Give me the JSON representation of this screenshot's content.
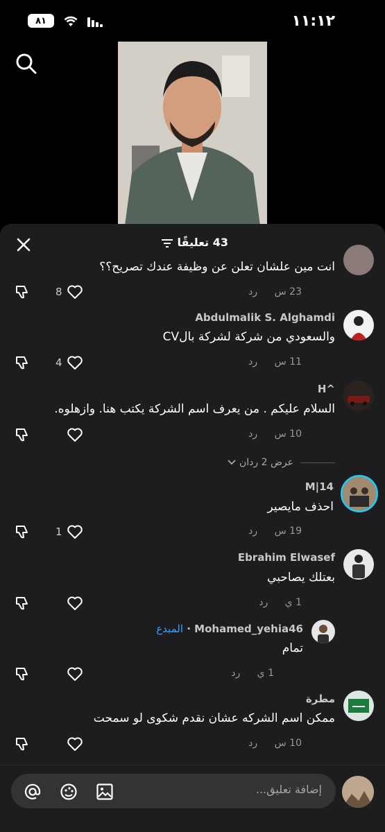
{
  "status": {
    "time": "١١:١٢",
    "battery": "٨١"
  },
  "video": {
    "description_icon": "video-person"
  },
  "sheet": {
    "count_label": "43 تعليقًا",
    "icons": {
      "close": "close-icon",
      "filter": "filter-icon"
    }
  },
  "comments": [
    {
      "name": "",
      "text": "انت مين علشان تعلن عن وظيفة عندك تصريح؟؟",
      "time": "23 س",
      "reply": "رد",
      "likes": "8"
    },
    {
      "name": "Abdulmalik S. Alghamdi",
      "text": "والسعودي من شركة لشركة بالCV",
      "time": "11 س",
      "reply": "رد",
      "likes": "4"
    },
    {
      "name": "H^",
      "text": "السلام عليكم . من يعرف اسم الشركة يكتب هنا. وازهلوه.",
      "time": "10 س",
      "reply": "رد",
      "likes": ""
    },
    {
      "name": "M|14",
      "text": "احذف مايصير",
      "time": "19 س",
      "reply": "رد",
      "likes": "1"
    },
    {
      "name": "Ebrahim Elwasef",
      "text": "بعتلك يصاحبي",
      "time": "1 ي",
      "reply": "رد",
      "likes": ""
    },
    {
      "name": "Mohamed_yehia46",
      "author_tag": "المبدع",
      "text": "تمام",
      "time": "1 ي",
      "reply": "رد",
      "likes": ""
    },
    {
      "name": "مطرة",
      "text": "ممكن اسم الشركه عشان نقدم شكوى لو سمحت",
      "time": "10 س",
      "reply": "رد",
      "likes": ""
    }
  ],
  "view_replies": {
    "label": "عرض 2 ردان"
  },
  "input": {
    "placeholder": "إضافة تعليق...",
    "icons": [
      "at-icon",
      "emoji-icon",
      "image-icon"
    ]
  },
  "colors": {
    "sheet_bg": "#1d1d1f",
    "accent": "#3aa0ff",
    "text_muted": "#9a9a9a"
  }
}
